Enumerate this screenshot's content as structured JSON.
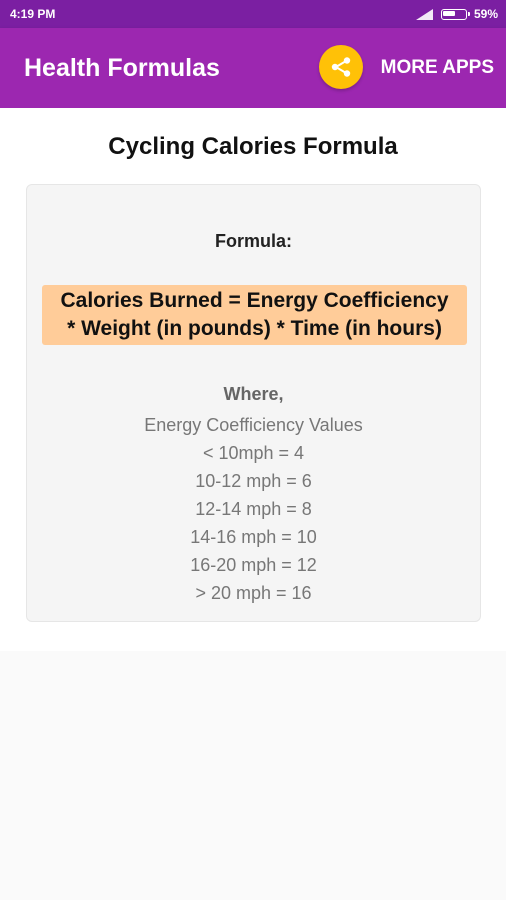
{
  "status_bar": {
    "time": "4:19 PM",
    "battery_percent": "59%",
    "battery_level": 0.59
  },
  "app_bar": {
    "title": "Health Formulas",
    "share_icon": "share-icon",
    "more_apps_label": "MORE APPS"
  },
  "colors": {
    "status_bar": "#7b1fa2",
    "app_bar": "#9c27b0",
    "share_button": "#ffc107",
    "formula_highlight": "#ffcc99"
  },
  "main": {
    "page_title": "Cycling Calories Formula",
    "formula_label": "Formula:",
    "formula_lines": [
      "Calories Burned = Energy Coefficiency",
      "* Weight (in pounds) * Time (in hours)"
    ],
    "where_label": "Where,",
    "values_heading": "Energy Coefficiency Values",
    "values": [
      "< 10mph = 4",
      "10-12 mph = 6",
      "12-14 mph = 8",
      "14-16 mph = 10",
      "16-20 mph = 12",
      "> 20 mph = 16"
    ]
  }
}
